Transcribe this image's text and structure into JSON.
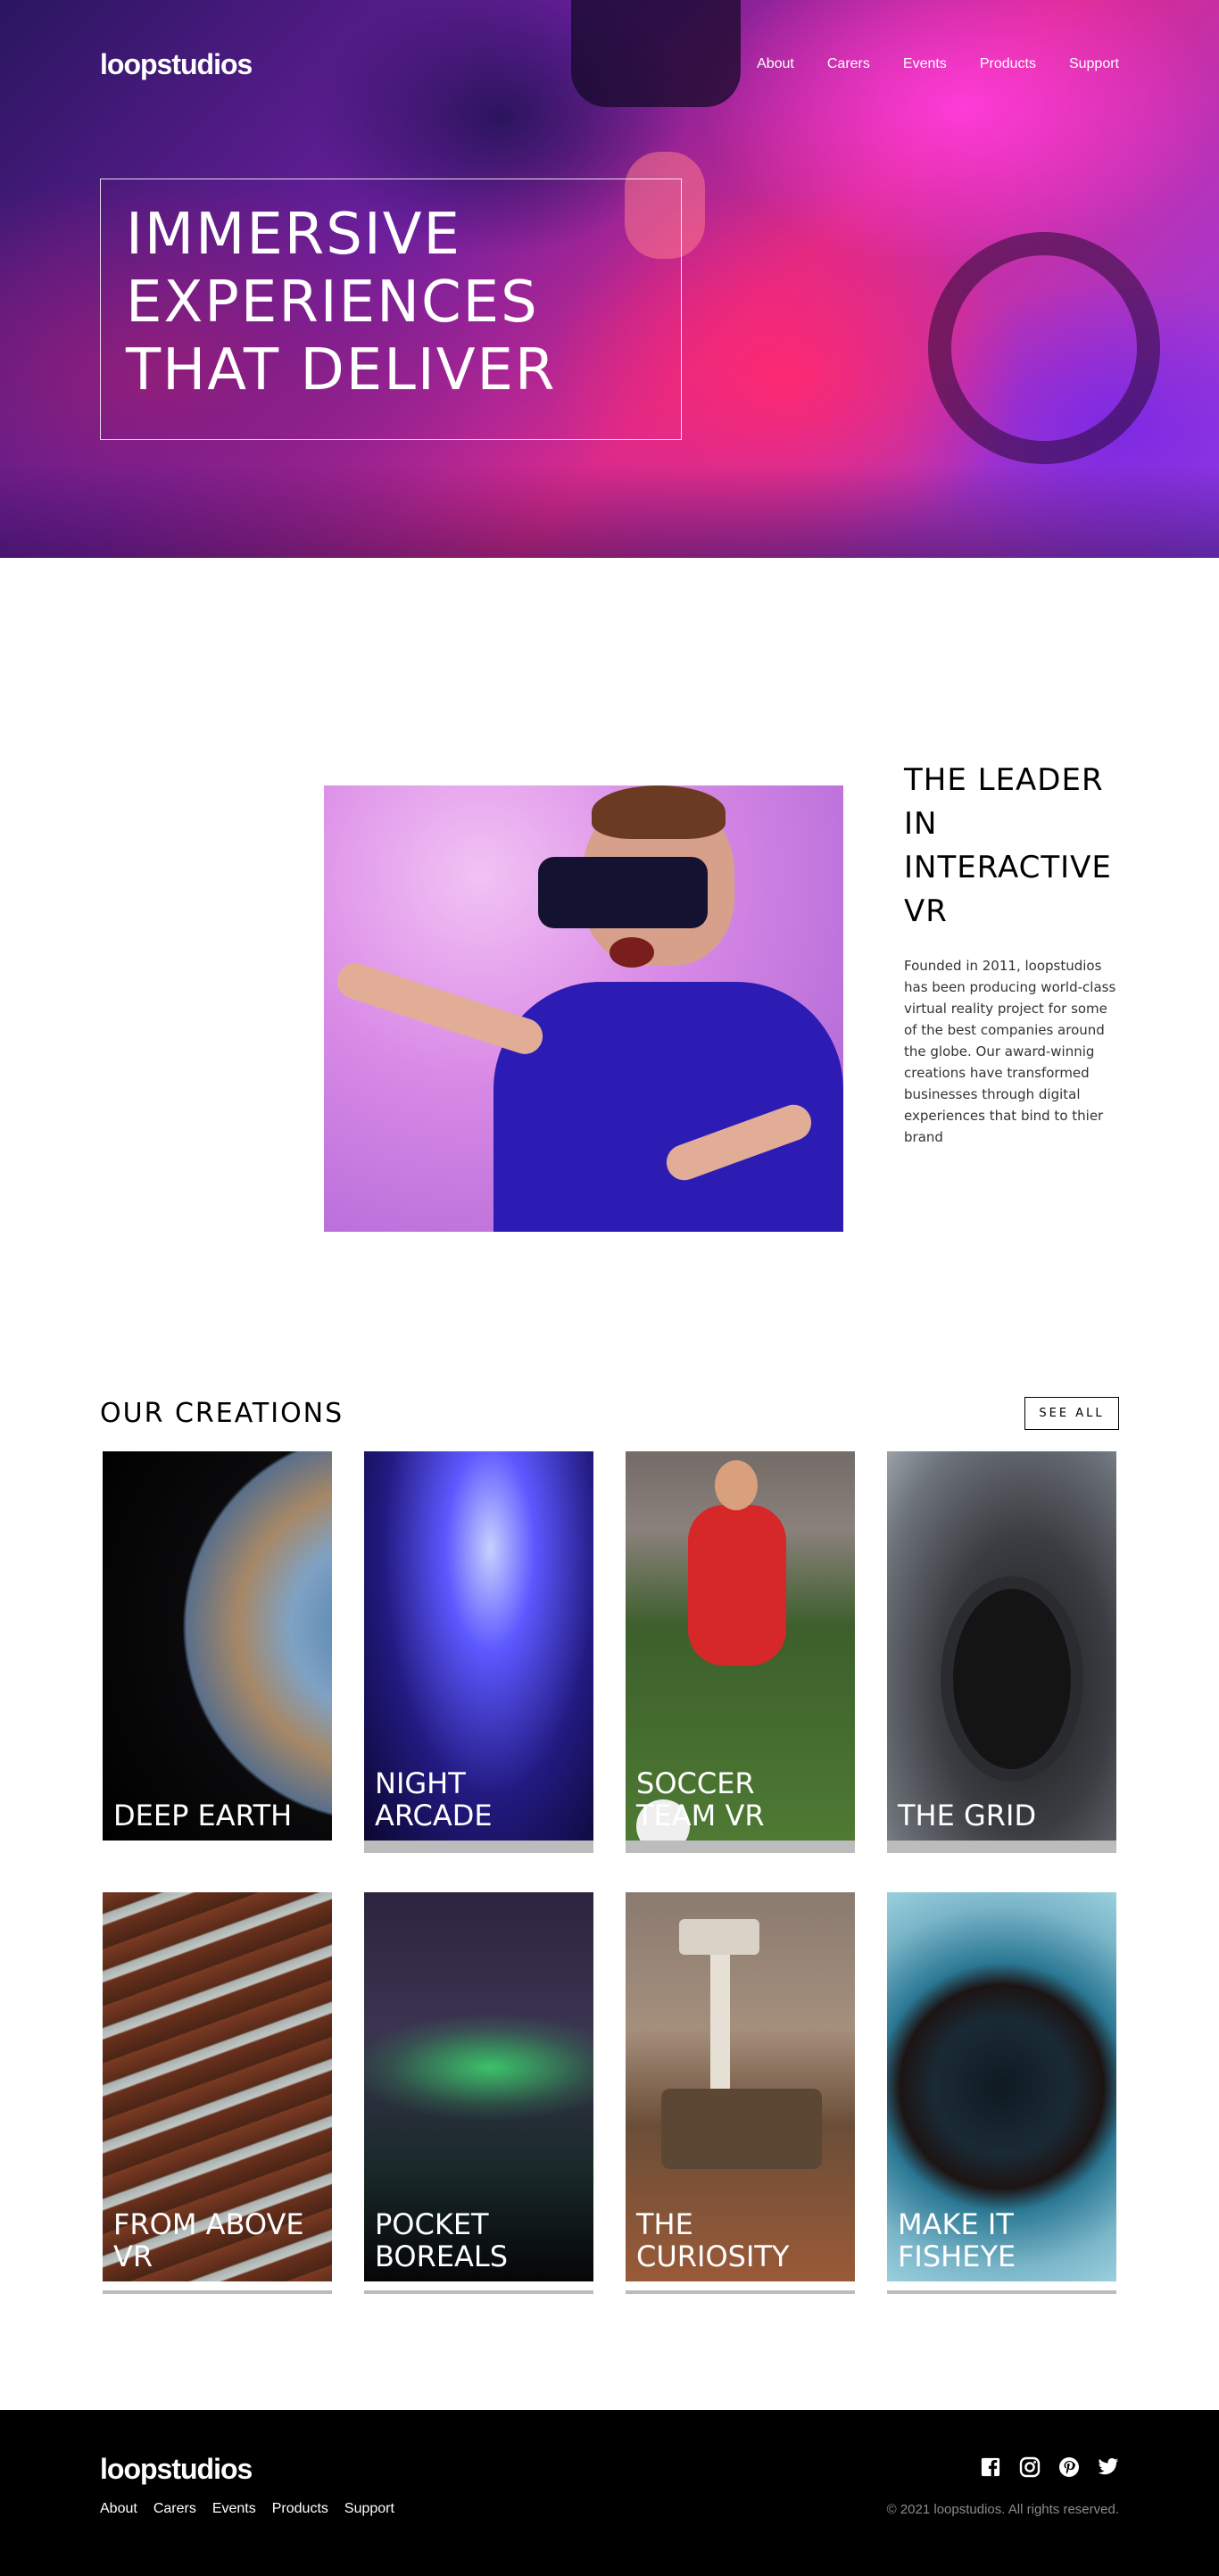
{
  "header": {
    "logo": "loopstudios",
    "nav": [
      "About",
      "Carers",
      "Events",
      "Products",
      "Support"
    ]
  },
  "hero": {
    "title": "IMMERSIVE EXPERIENCES THAT DELIVER"
  },
  "about": {
    "title": "THE LEADER IN INTERACTIVE VR",
    "body": "Founded in 2011, loopstudios has been producing world-class virtual reality project for some of the best companies around the globe. Our award-winnig creations have transformed businesses through digital experiences that bind to thier brand"
  },
  "creations": {
    "title": "OUR CREATIONS",
    "see_all": "SEE ALL",
    "items": [
      {
        "label": "DEEP EARTH"
      },
      {
        "label": "NIGHT ARCADE"
      },
      {
        "label": "SOCCER TEAM VR"
      },
      {
        "label": "THE GRID"
      },
      {
        "label": "FROM ABOVE VR"
      },
      {
        "label": "POCKET BOREALS"
      },
      {
        "label": "THE CURIOSITY"
      },
      {
        "label": "MAKE IT FISHEYE"
      }
    ]
  },
  "footer": {
    "logo": "loopstudios",
    "nav": [
      "About",
      "Carers",
      "Events",
      "Products",
      "Support"
    ],
    "social": [
      "facebook-icon",
      "instagram-icon",
      "pinterest-icon",
      "twitter-icon"
    ],
    "copyright": "© 2021 loopstudios. All rights reserved."
  },
  "colors": {
    "footer_bg": "#000000",
    "copyright": "#8a8a8a",
    "accent": "#d92a8d"
  }
}
